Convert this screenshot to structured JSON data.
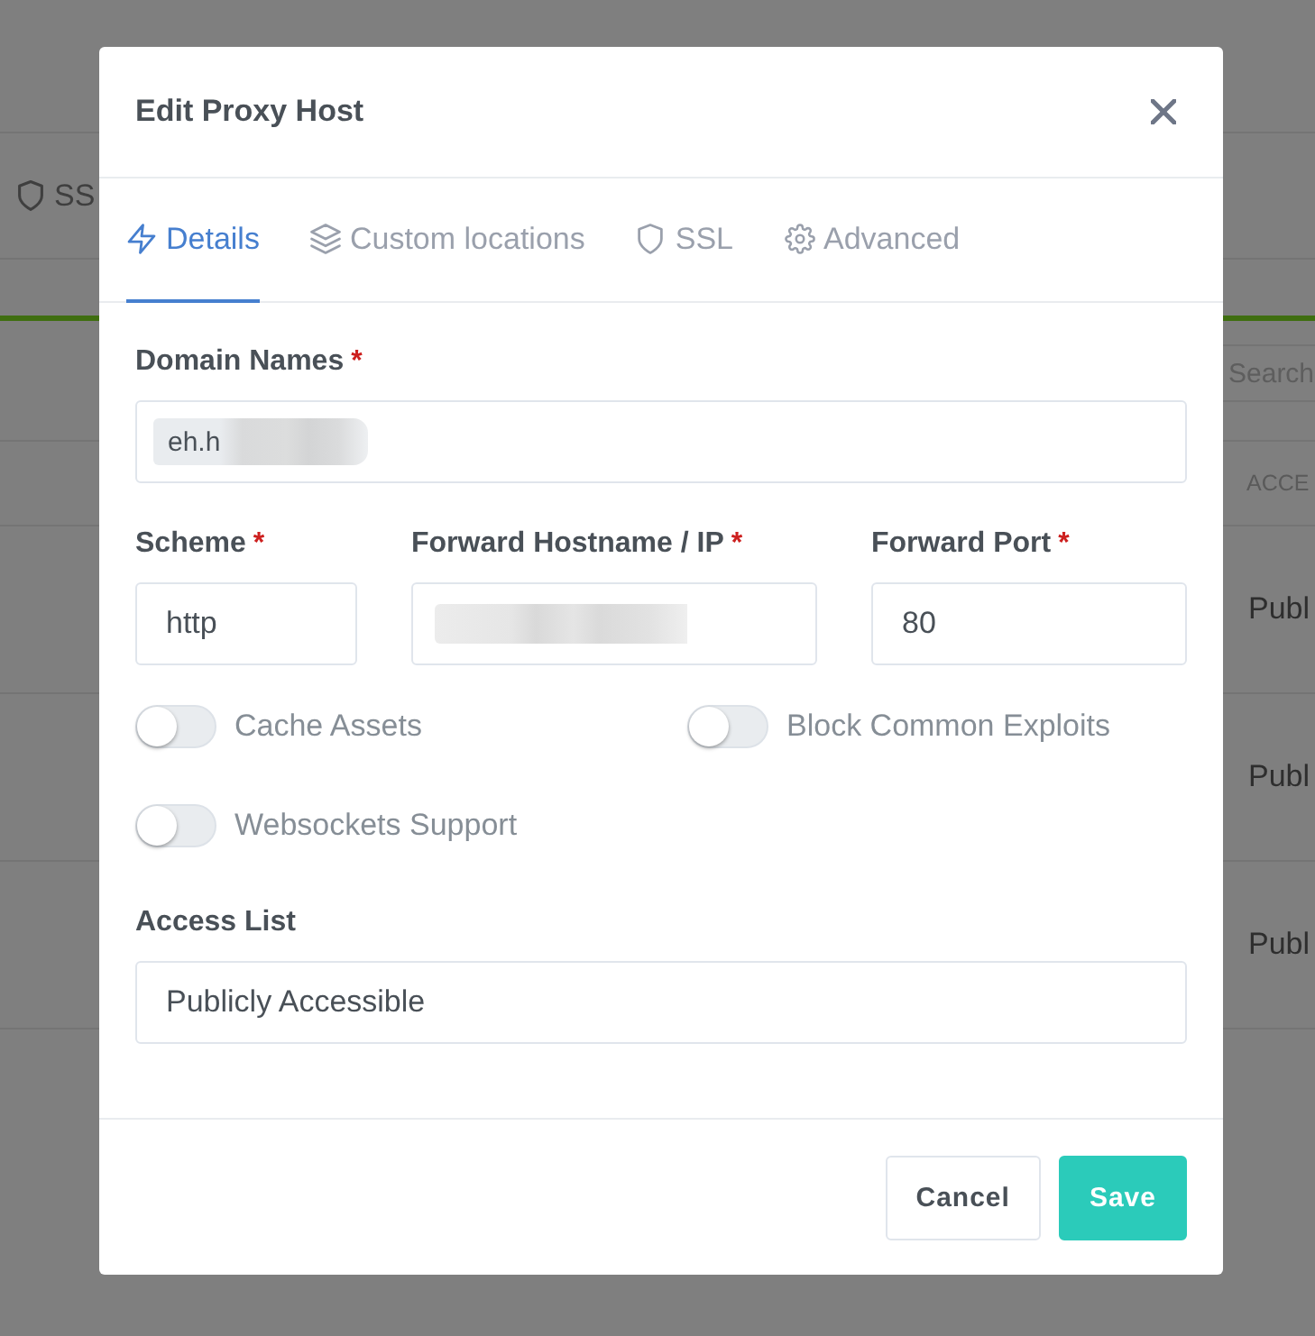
{
  "background_page": {
    "nav_tab": {
      "label": "SS"
    },
    "search_field": {
      "placeholder": "Search"
    },
    "table": {
      "column_header": "ACCE",
      "rows": [
        {
          "cell": "Publ"
        },
        {
          "cell": "Publ"
        },
        {
          "cell": "Publ"
        }
      ]
    }
  },
  "modal": {
    "title": "Edit Proxy Host",
    "tabs": [
      {
        "label": "Details",
        "selected": true
      },
      {
        "label": "Custom locations",
        "selected": false
      },
      {
        "label": "SSL",
        "selected": false
      },
      {
        "label": "Advanced",
        "selected": false
      }
    ],
    "domain_names": {
      "label": "Domain Names",
      "required_mark": "*",
      "tags": [
        {
          "text": "eh.h",
          "redacted": true
        }
      ]
    },
    "forward_fields": [
      {
        "label": "Scheme",
        "required_mark": "*",
        "value": "http"
      },
      {
        "label": "Forward Hostname / IP",
        "required_mark": "*",
        "redacted": true
      },
      {
        "label": "Forward Port",
        "required_mark": "*",
        "value": "80"
      }
    ],
    "toggles": [
      {
        "label": "Cache Assets",
        "on": false
      },
      {
        "label": "Block Common Exploits",
        "on": false
      },
      {
        "label": "Websockets Support",
        "on": false
      }
    ],
    "access_list": {
      "label": "Access List",
      "value": "Publicly Accessible"
    },
    "buttons": [
      {
        "label": "Cancel",
        "kind": "secondary"
      },
      {
        "label": "Save",
        "kind": "primary"
      }
    ]
  }
}
